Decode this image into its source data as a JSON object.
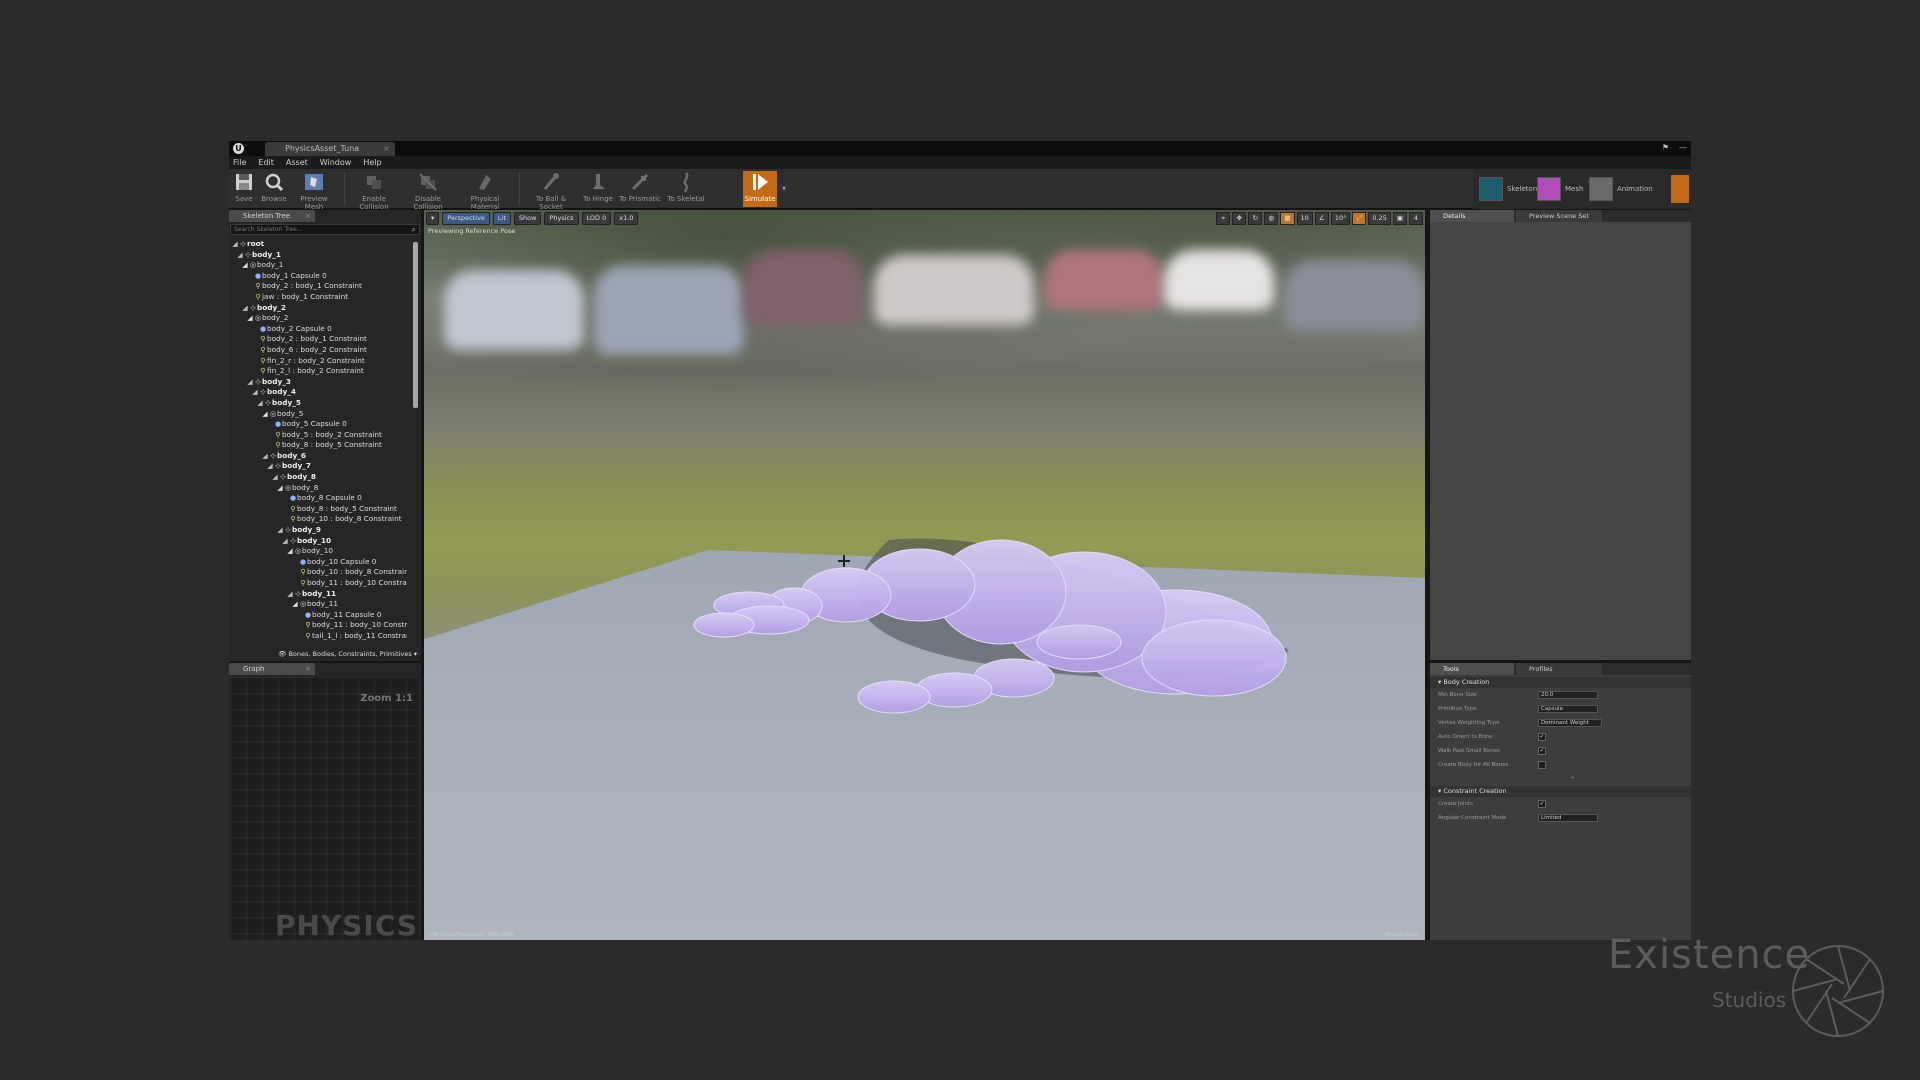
{
  "window": {
    "tab_title": "PhysicsAsset_Tuna"
  },
  "menu": [
    "File",
    "Edit",
    "Asset",
    "Window",
    "Help"
  ],
  "toolbar": {
    "buttons": [
      {
        "label": "Save",
        "icon": "save-icon"
      },
      {
        "label": "Browse",
        "icon": "browse-icon"
      },
      {
        "label": "Preview Mesh",
        "icon": "preview-mesh-icon"
      },
      {
        "label": "Enable Collision",
        "icon": "enable-collision-icon"
      },
      {
        "label": "Disable Collision",
        "icon": "disable-collision-icon"
      },
      {
        "label": "Physical Material",
        "icon": "physical-material-icon"
      },
      {
        "label": "To Ball & Socket",
        "icon": "ball-socket-icon"
      },
      {
        "label": "To Hinge",
        "icon": "hinge-icon"
      },
      {
        "label": "To Prismatic",
        "icon": "prismatic-icon"
      },
      {
        "label": "To Skeletal",
        "icon": "skeletal-icon"
      },
      {
        "label": "Simulate",
        "icon": "simulate-icon"
      }
    ],
    "modes": [
      {
        "label": "Skeleton",
        "color": "#1f5c6e"
      },
      {
        "label": "Mesh",
        "color": "#b04db6"
      },
      {
        "label": "Animation",
        "color": "#6a6a6a"
      }
    ]
  },
  "skeleton_tree": {
    "tab": "Skeleton Tree",
    "search_placeholder": "Search Skeleton Tree...",
    "nodes": [
      {
        "label": "root",
        "type": "bone",
        "depth": 0
      },
      {
        "label": "body_1",
        "type": "bone",
        "depth": 1
      },
      {
        "label": "body_1",
        "type": "body",
        "depth": 2
      },
      {
        "label": "body_1 Capsule 0",
        "type": "shape",
        "depth": 3
      },
      {
        "label": "body_2 : body_1 Constraint",
        "type": "constraint",
        "depth": 3
      },
      {
        "label": "jaw : body_1 Constraint",
        "type": "constraint",
        "depth": 3
      },
      {
        "label": "body_2",
        "type": "bone",
        "depth": 2
      },
      {
        "label": "body_2",
        "type": "body",
        "depth": 3
      },
      {
        "label": "body_2 Capsule 0",
        "type": "shape",
        "depth": 4
      },
      {
        "label": "body_2 : body_1 Constraint",
        "type": "constraint",
        "depth": 4
      },
      {
        "label": "body_6 : body_2 Constraint",
        "type": "constraint",
        "depth": 4
      },
      {
        "label": "fin_2_r : body_2 Constraint",
        "type": "constraint",
        "depth": 4
      },
      {
        "label": "fin_2_l : body_2 Constraint",
        "type": "constraint",
        "depth": 4
      },
      {
        "label": "body_3",
        "type": "bone",
        "depth": 3
      },
      {
        "label": "body_4",
        "type": "bone",
        "depth": 4
      },
      {
        "label": "body_5",
        "type": "bone",
        "depth": 5
      },
      {
        "label": "body_5",
        "type": "body",
        "depth": 6
      },
      {
        "label": "body_5 Capsule 0",
        "type": "shape",
        "depth": 7
      },
      {
        "label": "body_5 : body_2 Constraint",
        "type": "constraint",
        "depth": 7
      },
      {
        "label": "body_8 : body_5 Constraint",
        "type": "constraint",
        "depth": 7
      },
      {
        "label": "body_6",
        "type": "bone",
        "depth": 6
      },
      {
        "label": "body_7",
        "type": "bone",
        "depth": 7
      },
      {
        "label": "body_8",
        "type": "bone",
        "depth": 8
      },
      {
        "label": "body_8",
        "type": "body",
        "depth": 9
      },
      {
        "label": "body_8 Capsule 0",
        "type": "shape",
        "depth": 10
      },
      {
        "label": "body_8 : body_5 Constraint",
        "type": "constraint",
        "depth": 10
      },
      {
        "label": "body_10 : body_8 Constraint",
        "type": "constraint",
        "depth": 10
      },
      {
        "label": "body_9",
        "type": "bone",
        "depth": 9
      },
      {
        "label": "body_10",
        "type": "bone",
        "depth": 10
      },
      {
        "label": "body_10",
        "type": "body",
        "depth": 11
      },
      {
        "label": "body_10 Capsule 0",
        "type": "shape",
        "depth": 12
      },
      {
        "label": "body_10 : body_8 Constraint",
        "type": "constraint",
        "depth": 12
      },
      {
        "label": "body_11 : body_10 Constraint",
        "type": "constraint",
        "depth": 12
      },
      {
        "label": "body_11",
        "type": "bone",
        "depth": 11
      },
      {
        "label": "body_11",
        "type": "body",
        "depth": 12
      },
      {
        "label": "body_11 Capsule 0",
        "type": "shape",
        "depth": 13
      },
      {
        "label": "body_11 : body_10 Constraint",
        "type": "constraint",
        "depth": 13
      },
      {
        "label": "tail_1_l : body_11 Constraint",
        "type": "constraint",
        "depth": 13
      }
    ],
    "filter_label": "Bones, Bodies, Constraints, Primitives"
  },
  "graph": {
    "tab": "Graph",
    "zoom": "Zoom 1:1",
    "watermark": "PHYSICS"
  },
  "viewport": {
    "buttons": [
      "Perspective",
      "Lit",
      "Show",
      "Physics",
      "LOD 0",
      "x1.0"
    ],
    "info": "Previewing Reference Pose",
    "right_tools": [
      "10",
      "10°",
      "0.25",
      "4"
    ],
    "footer_left": "LMB Select/Manipulate, RMB Orbit",
    "footer_right": "Physics Asset"
  },
  "details": {
    "tabs": [
      "Details",
      "Preview Scene Set"
    ]
  },
  "tools": {
    "tabs": [
      "Tools",
      "Profiles"
    ],
    "sections": [
      {
        "title": "Body Creation",
        "props": [
          {
            "label": "Min Bone Size",
            "kind": "value",
            "value": "20.0"
          },
          {
            "label": "Primitive Type",
            "kind": "select",
            "value": "Capsule"
          },
          {
            "label": "Vertex Weighting Type",
            "kind": "select",
            "value": "Dominant Weight"
          },
          {
            "label": "Auto Orient to Bone",
            "kind": "check",
            "value": "✓"
          },
          {
            "label": "Walk Past Small Bones",
            "kind": "check",
            "value": "✓"
          },
          {
            "label": "Create Body for All Bones",
            "kind": "check",
            "value": ""
          }
        ]
      },
      {
        "title": "Constraint Creation",
        "props": [
          {
            "label": "Create Joints",
            "kind": "check",
            "value": "✓"
          },
          {
            "label": "Angular Constraint Mode",
            "kind": "select",
            "value": "Limited"
          }
        ]
      }
    ]
  },
  "brand": {
    "name": "Existence",
    "sub": "Studios"
  },
  "colors": {
    "accent": "#c26a16",
    "mesh": "#c7b3f0",
    "background": "#2b2b2b"
  }
}
